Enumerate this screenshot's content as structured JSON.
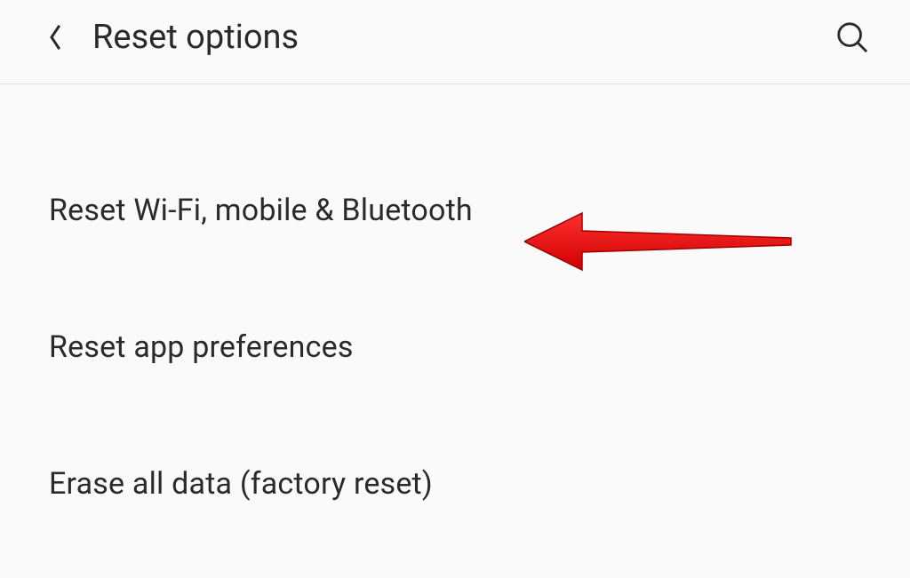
{
  "header": {
    "title": "Reset options"
  },
  "options": {
    "items": [
      {
        "label": "Reset Wi-Fi, mobile & Bluetooth"
      },
      {
        "label": "Reset app preferences"
      },
      {
        "label": "Erase all data (factory reset)"
      }
    ]
  }
}
